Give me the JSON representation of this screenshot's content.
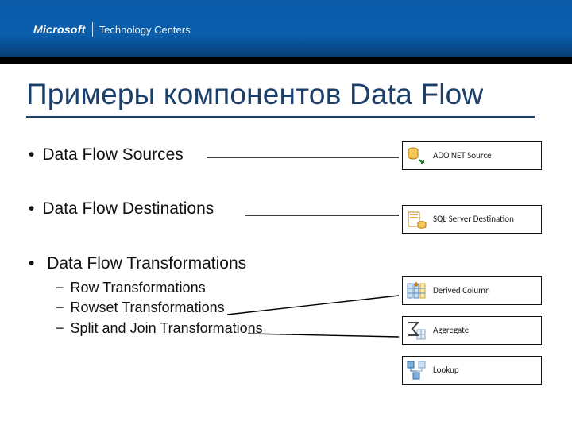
{
  "brand": {
    "company": "Microsoft",
    "subbrand": "Technology Centers"
  },
  "title": "Примеры компонентов Data Flow",
  "bullets": {
    "sources": "Data Flow Sources",
    "destinations": "Data Flow Destinations",
    "transformations": "Data Flow Transformations",
    "subs": {
      "row": "Row Transformations",
      "rowset": "Rowset Transformations",
      "splitjoin": "Split and Join Transformations"
    }
  },
  "components": {
    "adonet": {
      "label": "ADO NET Source",
      "icon": "database-source-icon"
    },
    "sqldest": {
      "label": "SQL Server Destination",
      "icon": "database-destination-icon"
    },
    "derived": {
      "label": "Derived Column",
      "icon": "derived-column-icon"
    },
    "aggregate": {
      "label": "Aggregate",
      "icon": "sigma-aggregate-icon"
    },
    "lookup": {
      "label": "Lookup",
      "icon": "lookup-icon"
    }
  }
}
